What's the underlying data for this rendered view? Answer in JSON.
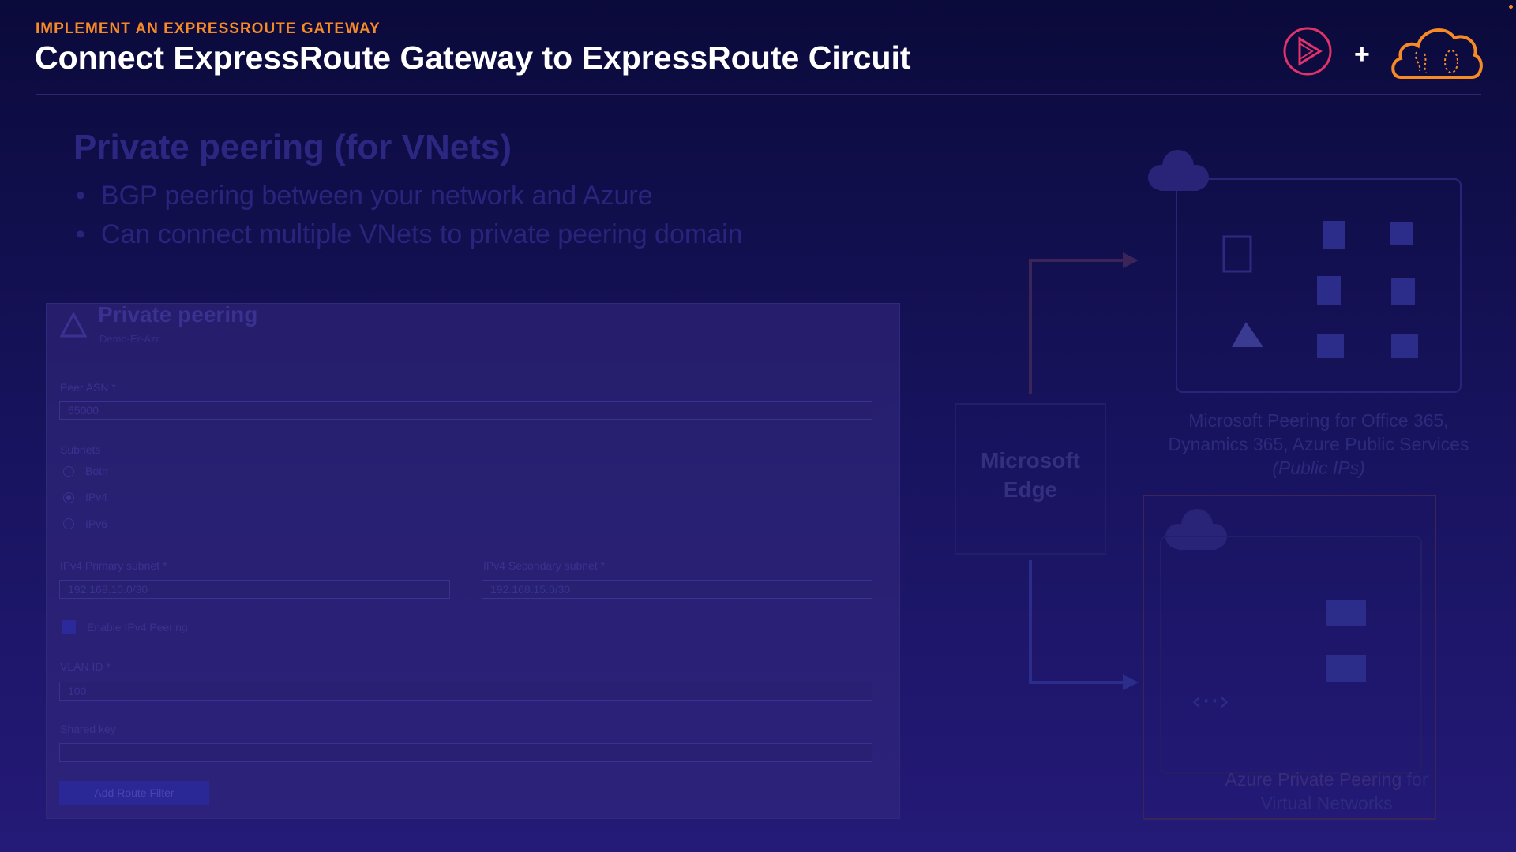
{
  "header": {
    "eyebrow": "IMPLEMENT AN EXPRESSROUTE GATEWAY",
    "title": "Connect ExpressRoute Gateway to ExpressRoute Circuit",
    "plus": "+"
  },
  "slide": {
    "heading": "Private peering (for VNets)",
    "bullets": [
      "BGP peering between your network and Azure",
      "Can connect multiple VNets to private peering domain"
    ]
  },
  "panel": {
    "title": "Private peering",
    "subtitle": "Demo-Er-Azr",
    "peer_asn_label": "Peer ASN *",
    "peer_asn_value": "65000",
    "subnets_label": "Subnets",
    "radio_options": [
      "Both",
      "IPv4",
      "IPv6"
    ],
    "selected_radio": "IPv4",
    "primary_subnet_label": "IPv4 Primary subnet *",
    "primary_subnet_value": "192.168.10.0/30",
    "secondary_subnet_label": "IPv4 Secondary subnet *",
    "secondary_subnet_value": "192.168.15.0/30",
    "ipv4_peering_label": "Enable IPv4 Peering",
    "vlan_label": "VLAN ID *",
    "vlan_value": "100",
    "shared_key_label": "Shared key",
    "shared_key_value": "",
    "save_label": "Add Route Filter"
  },
  "diagram": {
    "edge_label_line1": "Microsoft",
    "edge_label_line2": "Edge",
    "ms_peering_line1": "Microsoft Peering for Office 365,",
    "ms_peering_line2": "Dynamics 365, Azure Public Services",
    "ms_peering_line3": "(Public IPs)",
    "az_peering_accent": "Azure Private Peering",
    "az_peering_rest": "for",
    "az_peering_line2": "Virtual Networks"
  },
  "colors": {
    "accent_orange": "#f58a26",
    "brand_pink": "#e0336a",
    "background": "#16125a"
  }
}
